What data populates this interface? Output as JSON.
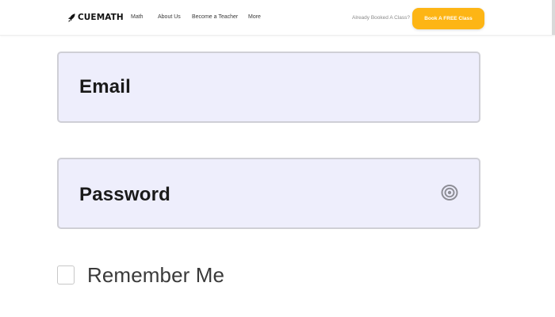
{
  "header": {
    "logo_text": "CUEMATH",
    "nav": {
      "math": "Math",
      "about": "About Us",
      "teacher": "Become a Teacher",
      "more": "More"
    },
    "booked_text": "Already Booked A Class?",
    "cta_label": "Book A FREE Class",
    "cta_color": "#fdb515"
  },
  "form": {
    "email_label": "Email",
    "password_label": "Password",
    "password_toggle_icon": "eye-icon",
    "remember_label": "Remember Me",
    "remember_checked": false,
    "field_bg_color": "#eeeefc"
  }
}
